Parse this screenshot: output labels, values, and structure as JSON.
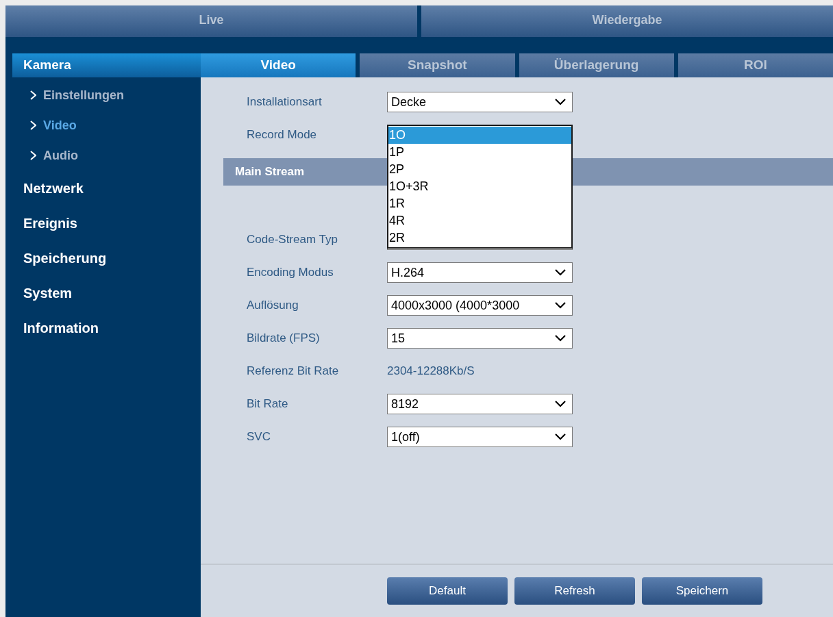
{
  "top_nav": [
    {
      "label": "Live",
      "selected": false
    },
    {
      "label": "Wiedergabe",
      "selected": false
    }
  ],
  "sidebar": {
    "header": "Kamera",
    "items": [
      {
        "label": "Einstellungen",
        "kind": "sub",
        "selected": false
      },
      {
        "label": "Video",
        "kind": "sub",
        "selected": true
      },
      {
        "label": "Audio",
        "kind": "sub",
        "selected": false
      },
      {
        "label": "Netzwerk",
        "kind": "main",
        "selected": false
      },
      {
        "label": "Ereignis",
        "kind": "main",
        "selected": false
      },
      {
        "label": "Speicherung",
        "kind": "main",
        "selected": false
      },
      {
        "label": "System",
        "kind": "main",
        "selected": false
      },
      {
        "label": "Information",
        "kind": "main",
        "selected": false
      }
    ]
  },
  "tabs": [
    {
      "label": "Video",
      "selected": true
    },
    {
      "label": "Snapshot",
      "selected": false
    },
    {
      "label": "Überlagerung",
      "selected": false
    },
    {
      "label": "ROI",
      "selected": false
    }
  ],
  "top_fields": [
    {
      "label": "Installationsart",
      "kind": "select",
      "value": "Decke"
    },
    {
      "label": "Record Mode",
      "kind": "open-select",
      "options": [
        {
          "label": "1O",
          "selected": true
        },
        {
          "label": "1P",
          "selected": false
        },
        {
          "label": "2P",
          "selected": false
        },
        {
          "label": "1O+3R",
          "selected": false
        },
        {
          "label": "1R",
          "selected": false
        },
        {
          "label": "4R",
          "selected": false
        },
        {
          "label": "2R",
          "selected": false
        }
      ]
    }
  ],
  "section_title": "Main Stream",
  "stream_fields": [
    {
      "label": "Code-Stream Typ",
      "kind": "covered-select"
    },
    {
      "label": "Encoding Modus",
      "kind": "select",
      "value": "H.264"
    },
    {
      "label": "Auflösung",
      "kind": "select",
      "value": "4000x3000 (4000*3000"
    },
    {
      "label": "Bildrate (FPS)",
      "kind": "select",
      "value": "15"
    },
    {
      "label": "Referenz Bit Rate",
      "kind": "text",
      "value": "2304-12288Kb/S"
    },
    {
      "label": "Bit Rate",
      "kind": "select",
      "value": "8192"
    },
    {
      "label": "SVC",
      "kind": "select",
      "value": "1(off)"
    }
  ],
  "buttons": [
    "Default",
    "Refresh",
    "Speichern"
  ]
}
